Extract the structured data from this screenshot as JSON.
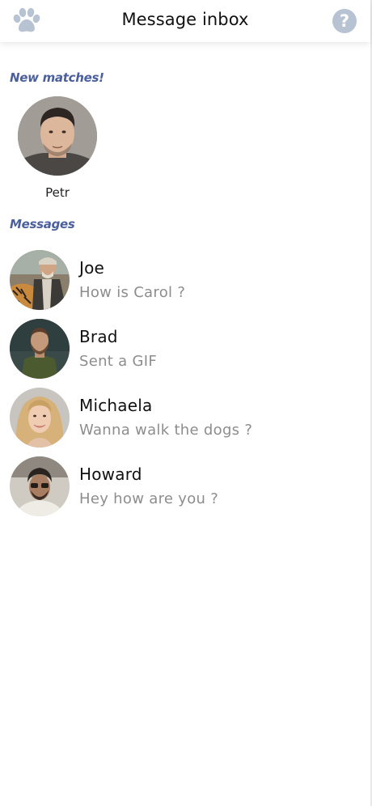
{
  "header": {
    "title": "Message inbox",
    "left_icon": "paw-icon",
    "help_label": "?"
  },
  "new_matches": {
    "heading": "New matches!",
    "items": [
      {
        "name": "Petr",
        "avatar": "avatar-photo"
      }
    ]
  },
  "messages": {
    "heading": "Messages",
    "items": [
      {
        "name": "Joe",
        "preview": "How is Carol ?",
        "avatar": "avatar-photo"
      },
      {
        "name": "Brad",
        "preview": "Sent a GIF",
        "avatar": "avatar-photo"
      },
      {
        "name": "Michaela",
        "preview": "Wanna walk the dogs ?",
        "avatar": "avatar-photo"
      },
      {
        "name": "Howard",
        "preview": "Hey how are you ?",
        "avatar": "avatar-photo"
      }
    ]
  },
  "colors": {
    "accent": "#4b5f9c",
    "icon_gray": "#b7c2d2",
    "preview_text": "#8d8d8d"
  }
}
